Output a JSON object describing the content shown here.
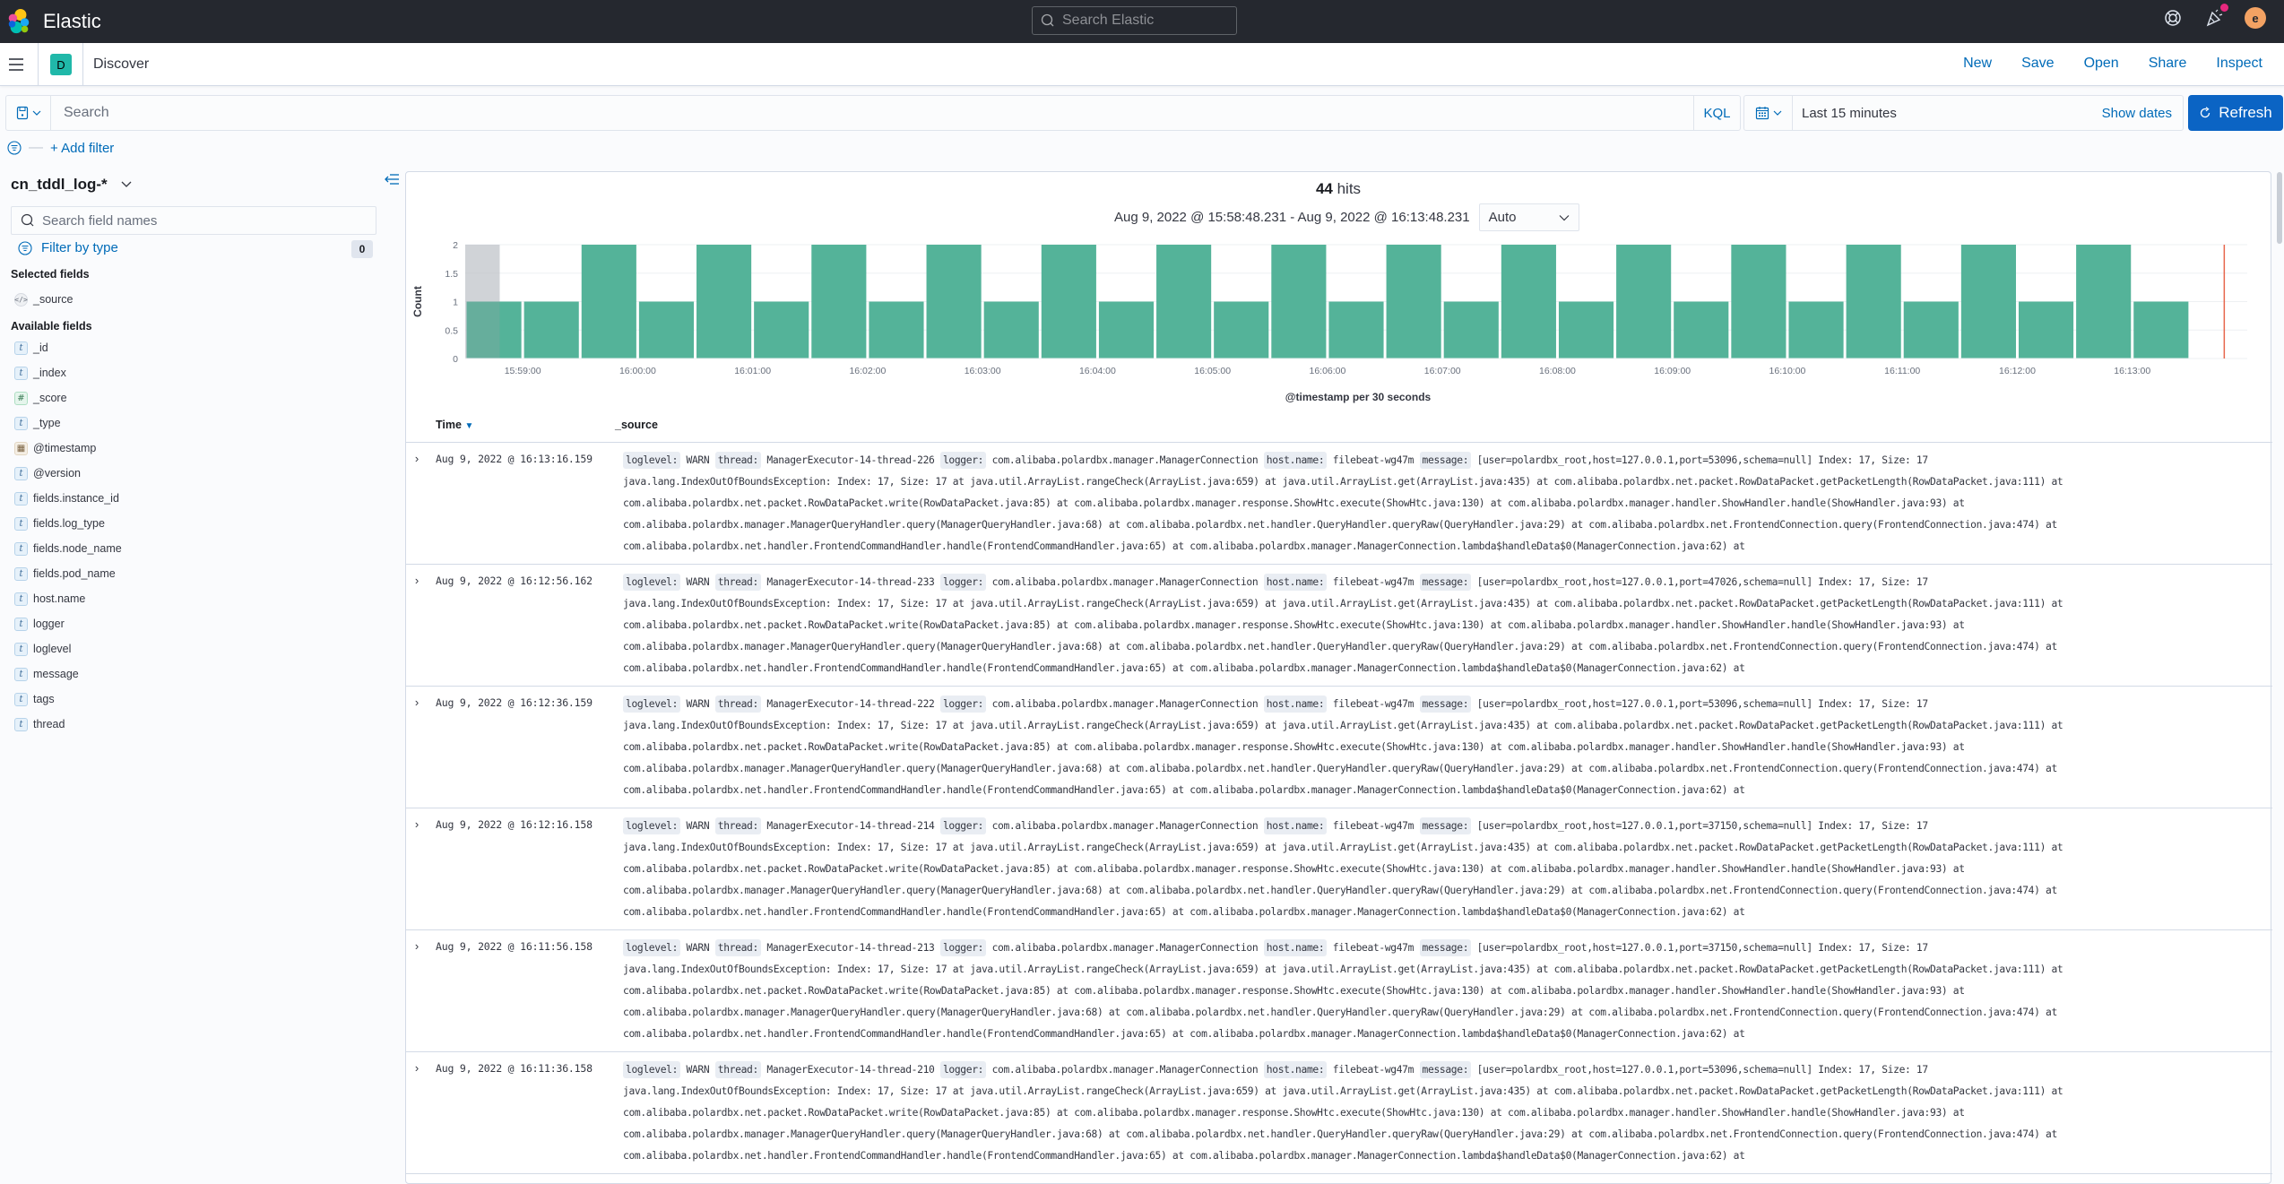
{
  "header": {
    "brand": "Elastic",
    "global_search_placeholder": "Search Elastic",
    "avatar_initial": "e"
  },
  "appbar": {
    "space_initial": "D",
    "breadcrumb": "Discover",
    "actions": [
      "New",
      "Save",
      "Open",
      "Share",
      "Inspect"
    ]
  },
  "querybar": {
    "placeholder": "Search",
    "value": "",
    "language": "KQL",
    "time_range": "Last 15 minutes",
    "show_dates_label": "Show dates",
    "refresh_label": "Refresh",
    "add_filter_label": "+ Add filter"
  },
  "sidebar": {
    "index_pattern": "cn_tddl_log-*",
    "field_search_placeholder": "Search field names",
    "filter_by_type_label": "Filter by type",
    "filter_count": "0",
    "selected_title": "Selected fields",
    "selected_fields": [
      {
        "name": "_source",
        "type": "source"
      }
    ],
    "available_title": "Available fields",
    "available_fields": [
      {
        "name": "_id",
        "type": "string"
      },
      {
        "name": "_index",
        "type": "string"
      },
      {
        "name": "_score",
        "type": "number"
      },
      {
        "name": "_type",
        "type": "string"
      },
      {
        "name": "@timestamp",
        "type": "date"
      },
      {
        "name": "@version",
        "type": "string"
      },
      {
        "name": "fields.instance_id",
        "type": "string"
      },
      {
        "name": "fields.log_type",
        "type": "string"
      },
      {
        "name": "fields.node_name",
        "type": "string"
      },
      {
        "name": "fields.pod_name",
        "type": "string"
      },
      {
        "name": "host.name",
        "type": "string"
      },
      {
        "name": "logger",
        "type": "string"
      },
      {
        "name": "loglevel",
        "type": "string"
      },
      {
        "name": "message",
        "type": "string"
      },
      {
        "name": "tags",
        "type": "string"
      },
      {
        "name": "thread",
        "type": "string"
      }
    ]
  },
  "results": {
    "hits_count": "44",
    "hits_label": "hits",
    "range": "Aug 9, 2022 @ 15:58:48.231 - Aug 9, 2022 @ 16:13:48.231",
    "interval": "Auto"
  },
  "chart_data": {
    "type": "bar",
    "title": "",
    "xlabel": "@timestamp per 30 seconds",
    "ylabel": "Count",
    "ylim": [
      0,
      2
    ],
    "yticks": [
      "0",
      "0.5",
      "1",
      "1.5",
      "2"
    ],
    "bar_color": "#54b399",
    "grid": true,
    "categories": [
      "15:58:30",
      "15:59:00",
      "15:59:30",
      "16:00:00",
      "16:00:30",
      "16:01:00",
      "16:01:30",
      "16:02:00",
      "16:02:30",
      "16:03:00",
      "16:03:30",
      "16:04:00",
      "16:04:30",
      "16:05:00",
      "16:05:30",
      "16:06:00",
      "16:06:30",
      "16:07:00",
      "16:07:30",
      "16:08:00",
      "16:08:30",
      "16:09:00",
      "16:09:30",
      "16:10:00",
      "16:10:30",
      "16:11:00",
      "16:11:30",
      "16:12:00",
      "16:12:30",
      "16:13:00"
    ],
    "values": [
      1,
      1,
      2,
      1,
      2,
      1,
      2,
      1,
      2,
      1,
      2,
      1,
      2,
      1,
      2,
      1,
      2,
      1,
      2,
      1,
      2,
      1,
      2,
      1,
      2,
      1,
      2,
      1,
      2,
      1
    ],
    "xtick_labels": [
      "15:59:00",
      "16:00:00",
      "16:01:00",
      "16:02:00",
      "16:03:00",
      "16:04:00",
      "16:05:00",
      "16:06:00",
      "16:07:00",
      "16:08:00",
      "16:09:00",
      "16:10:00",
      "16:11:00",
      "16:12:00",
      "16:13:00"
    ],
    "x_range": [
      "15:58:30",
      "16:14:00"
    ],
    "out_of_range_shading_until": "15:58:48",
    "now_marker": "16:13:48"
  },
  "table": {
    "col_time": "Time",
    "col_source": "_source",
    "field_labels": {
      "loglevel": "loglevel:",
      "thread": "thread:",
      "logger": "logger:",
      "host": "host.name:",
      "message": "message:"
    },
    "rows": [
      {
        "time": "Aug 9, 2022 @ 16:13:16.159",
        "loglevel": "WARN",
        "thread": "ManagerExecutor-14-thread-226",
        "logger": "com.alibaba.polardbx.manager.ManagerConnection",
        "host": "filebeat-wg47m",
        "message_head": "[user=polardbx_root,host=127.0.0.1,port=53096,schema=null] Index: 17, Size: 17"
      },
      {
        "time": "Aug 9, 2022 @ 16:12:56.162",
        "loglevel": "WARN",
        "thread": "ManagerExecutor-14-thread-233",
        "logger": "com.alibaba.polardbx.manager.ManagerConnection",
        "host": "filebeat-wg47m",
        "message_head": "[user=polardbx_root,host=127.0.0.1,port=47026,schema=null] Index: 17, Size: 17"
      },
      {
        "time": "Aug 9, 2022 @ 16:12:36.159",
        "loglevel": "WARN",
        "thread": "ManagerExecutor-14-thread-222",
        "logger": "com.alibaba.polardbx.manager.ManagerConnection",
        "host": "filebeat-wg47m",
        "message_head": "[user=polardbx_root,host=127.0.0.1,port=53096,schema=null] Index: 17, Size: 17"
      },
      {
        "time": "Aug 9, 2022 @ 16:12:16.158",
        "loglevel": "WARN",
        "thread": "ManagerExecutor-14-thread-214",
        "logger": "com.alibaba.polardbx.manager.ManagerConnection",
        "host": "filebeat-wg47m",
        "message_head": "[user=polardbx_root,host=127.0.0.1,port=37150,schema=null] Index: 17, Size: 17"
      },
      {
        "time": "Aug 9, 2022 @ 16:11:56.158",
        "loglevel": "WARN",
        "thread": "ManagerExecutor-14-thread-213",
        "logger": "com.alibaba.polardbx.manager.ManagerConnection",
        "host": "filebeat-wg47m",
        "message_head": "[user=polardbx_root,host=127.0.0.1,port=37150,schema=null] Index: 17, Size: 17"
      },
      {
        "time": "Aug 9, 2022 @ 16:11:36.158",
        "loglevel": "WARN",
        "thread": "ManagerExecutor-14-thread-210",
        "logger": "com.alibaba.polardbx.manager.ManagerConnection",
        "host": "filebeat-wg47m",
        "message_head": "[user=polardbx_root,host=127.0.0.1,port=53096,schema=null] Index: 17, Size: 17"
      }
    ],
    "stack_lines": [
      "java.lang.IndexOutOfBoundsException: Index: 17, Size: 17 at java.util.ArrayList.rangeCheck(ArrayList.java:659) at java.util.ArrayList.get(ArrayList.java:435) at com.alibaba.polardbx.net.packet.RowDataPacket.getPacketLength(RowDataPacket.java:111) at",
      "com.alibaba.polardbx.net.packet.RowDataPacket.write(RowDataPacket.java:85) at com.alibaba.polardbx.manager.response.ShowHtc.execute(ShowHtc.java:130) at com.alibaba.polardbx.manager.handler.ShowHandler.handle(ShowHandler.java:93) at",
      "com.alibaba.polardbx.manager.ManagerQueryHandler.query(ManagerQueryHandler.java:68) at com.alibaba.polardbx.net.handler.QueryHandler.queryRaw(QueryHandler.java:29) at com.alibaba.polardbx.net.FrontendConnection.query(FrontendConnection.java:474) at",
      "com.alibaba.polardbx.net.handler.FrontendCommandHandler.handle(FrontendCommandHandler.java:65) at com.alibaba.polardbx.manager.ManagerConnection.lambda$handleData$0(ManagerConnection.java:62) at"
    ]
  }
}
